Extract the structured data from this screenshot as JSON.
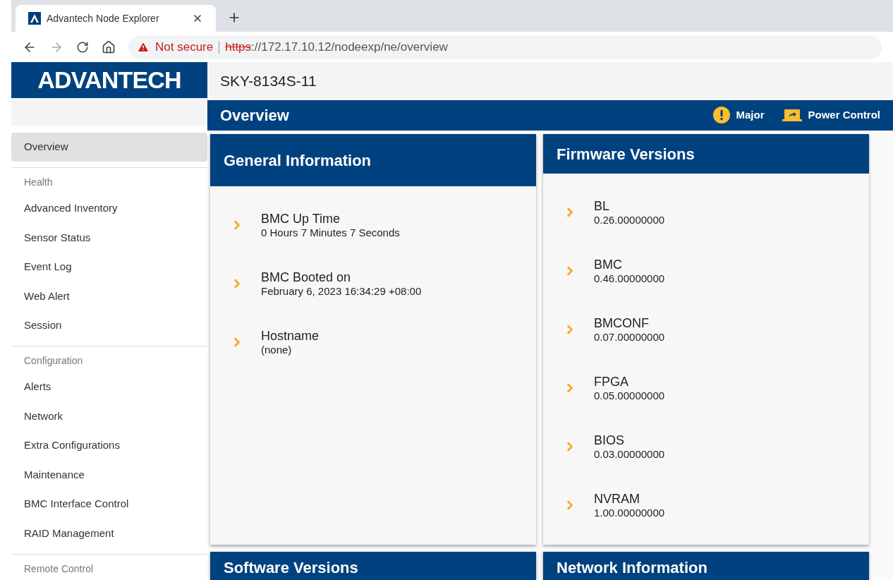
{
  "browser": {
    "tab": {
      "title": "Advantech Node Explorer",
      "selected": true
    },
    "url": {
      "security": "Not secure",
      "scheme": "https",
      "rest": "://172.17.10.12/nodeexp/ne/overview"
    }
  },
  "logo": "ADVANTECH",
  "device_name": "SKY-8134S-11",
  "page_title": "Overview",
  "header_actions": [
    {
      "kind": "alert",
      "label": "Major"
    },
    {
      "kind": "power",
      "label": "Power Control"
    }
  ],
  "sidebar": [
    {
      "kind": "item",
      "label": "Overview",
      "selected": true
    },
    {
      "kind": "heading",
      "label": "Health"
    },
    {
      "kind": "item",
      "label": "Advanced Inventory",
      "selected": false
    },
    {
      "kind": "item",
      "label": "Sensor Status",
      "selected": false
    },
    {
      "kind": "item",
      "label": "Event Log",
      "selected": false
    },
    {
      "kind": "item",
      "label": "Web Alert",
      "selected": false
    },
    {
      "kind": "item",
      "label": "Session",
      "selected": false
    },
    {
      "kind": "heading",
      "label": "Configuration"
    },
    {
      "kind": "item",
      "label": "Alerts",
      "selected": false
    },
    {
      "kind": "item",
      "label": "Network",
      "selected": false
    },
    {
      "kind": "item",
      "label": "Extra Configurations",
      "selected": false
    },
    {
      "kind": "item",
      "label": "Maintenance",
      "selected": false
    },
    {
      "kind": "item",
      "label": "BMC Interface Control",
      "selected": false
    },
    {
      "kind": "item",
      "label": "RAID Management",
      "selected": false
    },
    {
      "kind": "heading",
      "label": "Remote Control"
    }
  ],
  "cards": [
    {
      "title": "General Information",
      "rows": [
        {
          "label": "BMC Up Time",
          "value": "0 Hours 7 Minutes 7 Seconds"
        },
        {
          "label": "BMC Booted on",
          "value": "February 6, 2023 16:34:29 +08:00"
        },
        {
          "label": "Hostname",
          "value": "(none)"
        }
      ]
    },
    {
      "title": "Firmware Versions",
      "rows": [
        {
          "label": "BL",
          "value": "0.26.00000000"
        },
        {
          "label": "BMC",
          "value": "0.46.00000000"
        },
        {
          "label": "BMCONF",
          "value": "0.07.00000000"
        },
        {
          "label": "FPGA",
          "value": "0.05.00000000"
        },
        {
          "label": "BIOS",
          "value": "0.03.00000000"
        },
        {
          "label": "NVRAM",
          "value": "1.00.00000000"
        }
      ]
    },
    {
      "title": "Software Versions"
    },
    {
      "title": "Network Information"
    }
  ]
}
